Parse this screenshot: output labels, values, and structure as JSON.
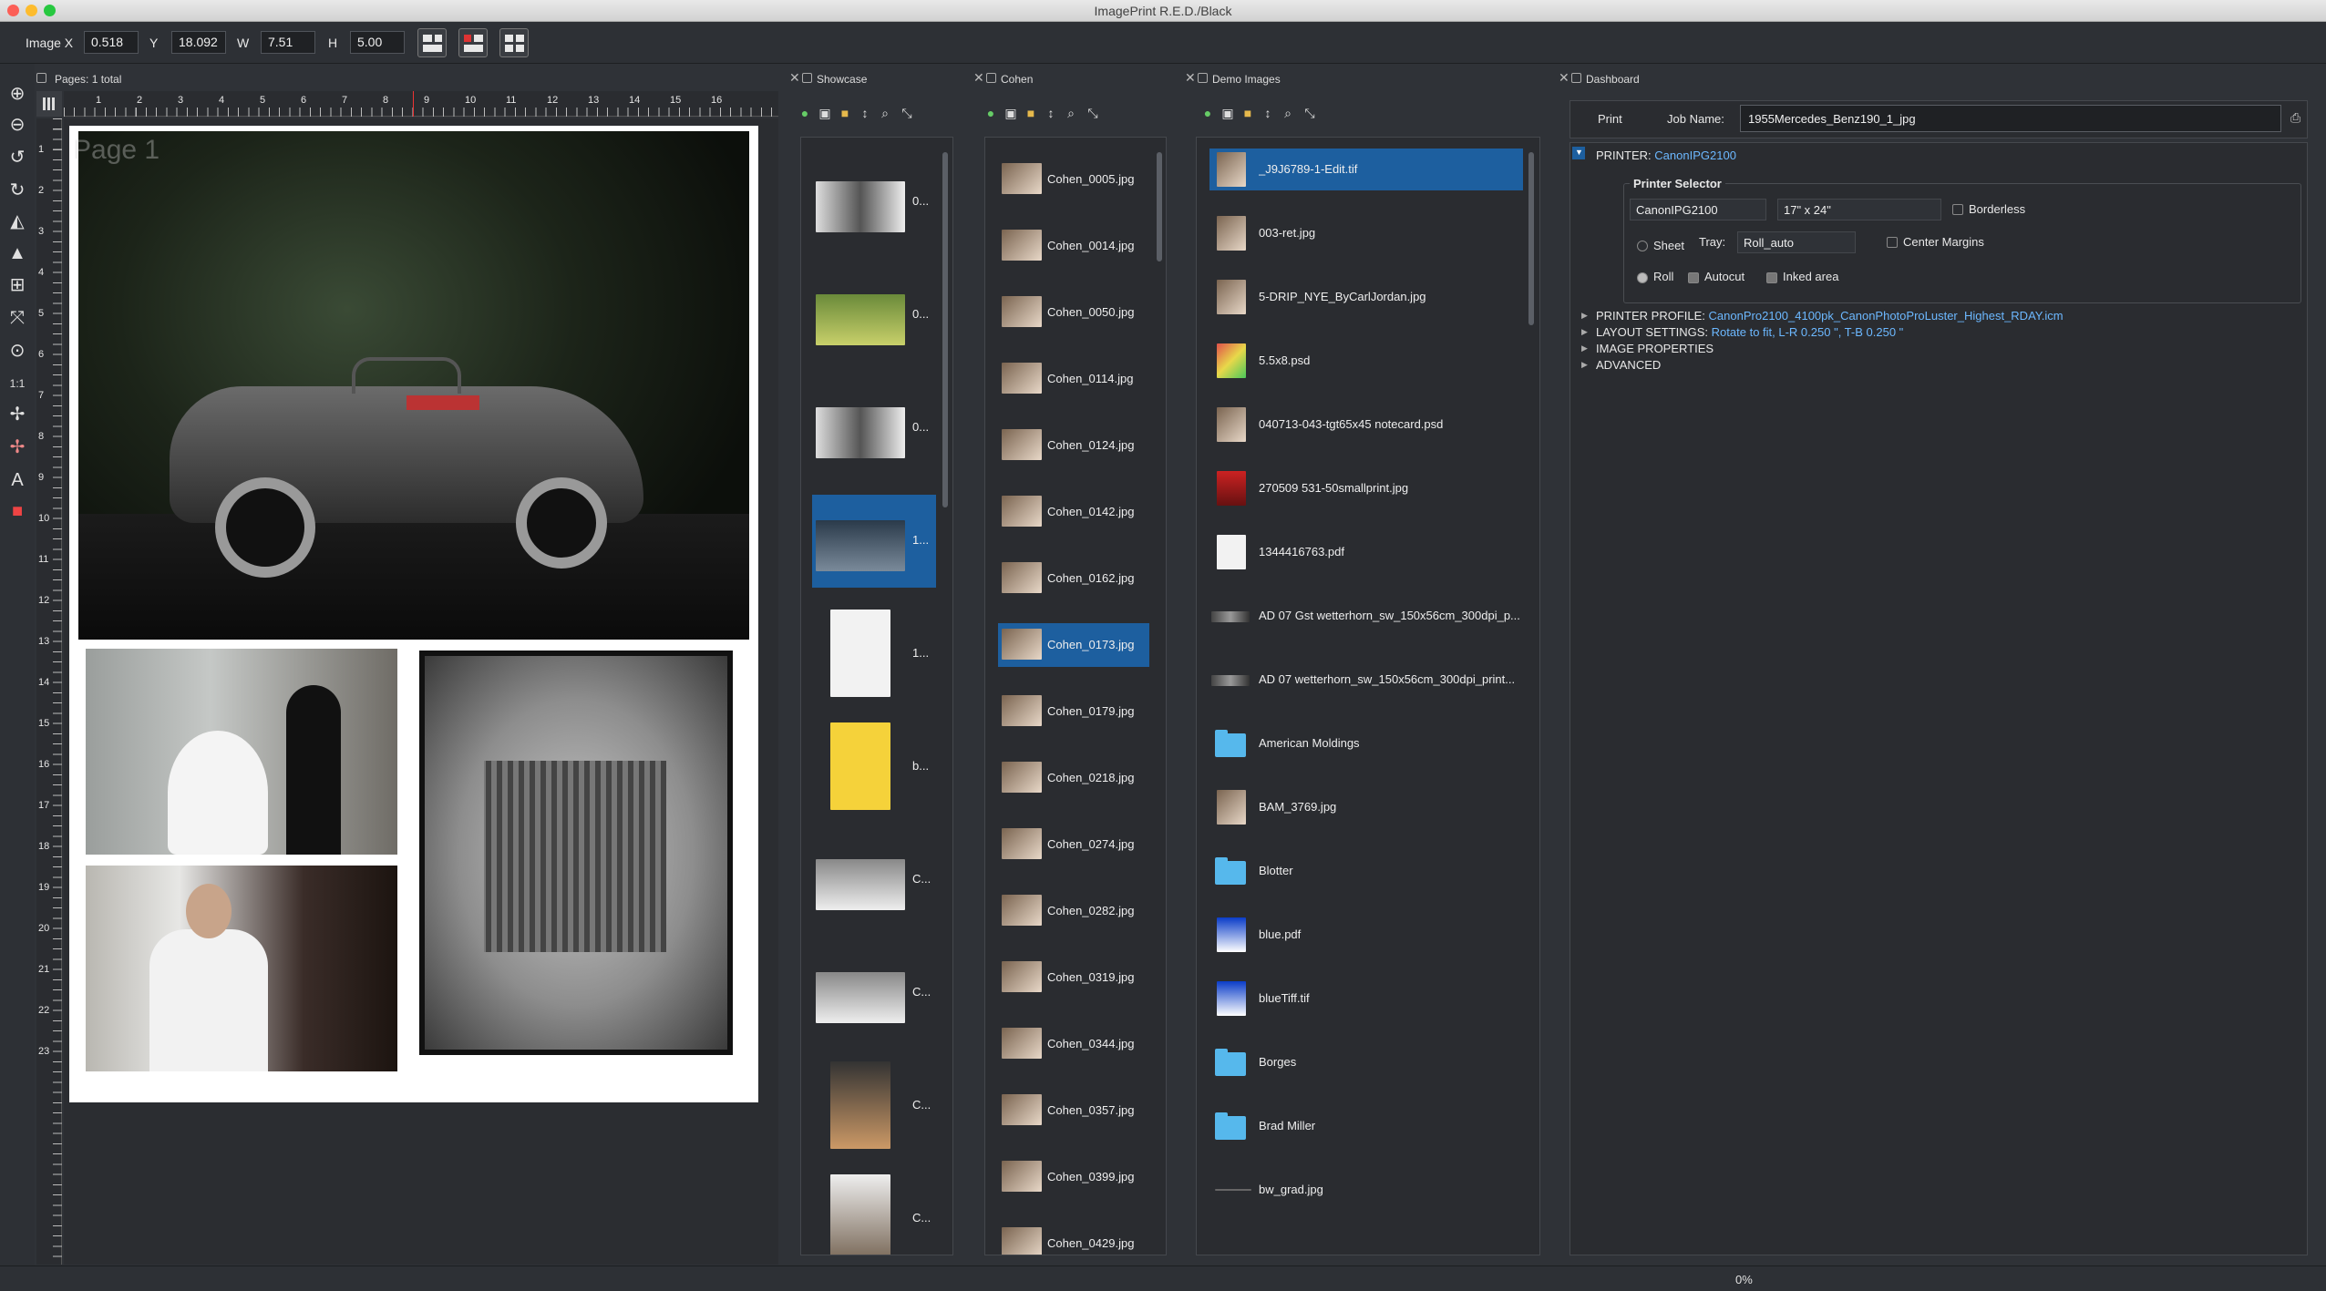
{
  "window": {
    "title": "ImagePrint R.E.D./Black"
  },
  "toolbar": {
    "image_x_label": "Image X",
    "image_x": "0.518",
    "y_label": "Y",
    "y": "18.092",
    "w_label": "W",
    "w": "7.51",
    "h_label": "H",
    "h": "5.00"
  },
  "canvas": {
    "pages_label": "Pages: 1 total",
    "page_watermark": "Page 1",
    "ruler_top": [
      "1",
      "2",
      "3",
      "4",
      "5",
      "6",
      "7",
      "8",
      "9",
      "10",
      "11",
      "12",
      "13",
      "14",
      "15",
      "16"
    ],
    "ruler_left": [
      "1",
      "2",
      "3",
      "4",
      "5",
      "6",
      "7",
      "8",
      "9",
      "10",
      "11",
      "12",
      "13",
      "14",
      "15",
      "16",
      "17",
      "18",
      "19",
      "20",
      "21",
      "22",
      "23"
    ]
  },
  "showcase": {
    "title": "Showcase",
    "items": [
      {
        "label": "0...",
        "kind": "bw"
      },
      {
        "label": "0...",
        "kind": "green"
      },
      {
        "label": "0...",
        "kind": "bw"
      },
      {
        "label": "1...",
        "kind": "car",
        "selected": true
      },
      {
        "label": "1...",
        "kind": "sketch"
      },
      {
        "label": "b...",
        "kind": "bart"
      },
      {
        "label": "C...",
        "kind": "street"
      },
      {
        "label": "C...",
        "kind": "street"
      },
      {
        "label": "C...",
        "kind": "dark"
      },
      {
        "label": "C...",
        "kind": "portrait"
      }
    ]
  },
  "cohen": {
    "title": "Cohen",
    "items": [
      {
        "label": "Cohen_0005.jpg"
      },
      {
        "label": "Cohen_0014.jpg"
      },
      {
        "label": "Cohen_0050.jpg"
      },
      {
        "label": "Cohen_0114.jpg"
      },
      {
        "label": "Cohen_0124.jpg"
      },
      {
        "label": "Cohen_0142.jpg"
      },
      {
        "label": "Cohen_0162.jpg"
      },
      {
        "label": "Cohen_0173.jpg",
        "selected": true
      },
      {
        "label": "Cohen_0179.jpg"
      },
      {
        "label": "Cohen_0218.jpg"
      },
      {
        "label": "Cohen_0274.jpg"
      },
      {
        "label": "Cohen_0282.jpg"
      },
      {
        "label": "Cohen_0319.jpg"
      },
      {
        "label": "Cohen_0344.jpg"
      },
      {
        "label": "Cohen_0357.jpg"
      },
      {
        "label": "Cohen_0399.jpg"
      },
      {
        "label": "Cohen_0429.jpg"
      }
    ]
  },
  "demo": {
    "title": "Demo Images",
    "items": [
      {
        "label": "_J9J6789-1-Edit.tif",
        "kind": "photo",
        "selected": true
      },
      {
        "label": "003-ret.jpg",
        "kind": "photo"
      },
      {
        "label": "5-DRIP_NYE_ByCarlJordan.jpg",
        "kind": "photo"
      },
      {
        "label": "5.5x8.psd",
        "kind": "gradient"
      },
      {
        "label": "040713-043-tgt65x45 notecard.psd",
        "kind": "photo"
      },
      {
        "label": "270509 531-50smallprint.jpg",
        "kind": "red"
      },
      {
        "label": "1344416763.pdf",
        "kind": "sketch"
      },
      {
        "label": "AD 07 Gst wetterhorn_sw_150x56cm_300dpi_p...",
        "kind": "pano"
      },
      {
        "label": "AD 07 wetterhorn_sw_150x56cm_300dpi_print...",
        "kind": "pano"
      },
      {
        "label": "American Moldings",
        "kind": "folder"
      },
      {
        "label": "BAM_3769.jpg",
        "kind": "photo"
      },
      {
        "label": "Blotter",
        "kind": "folder"
      },
      {
        "label": "blue.pdf",
        "kind": "blue"
      },
      {
        "label": "blueTiff.tif",
        "kind": "blue"
      },
      {
        "label": "Borges",
        "kind": "folder"
      },
      {
        "label": "Brad Miller",
        "kind": "folder"
      },
      {
        "label": "bw_grad.jpg",
        "kind": "line"
      }
    ]
  },
  "dashboard": {
    "title": "Dashboard",
    "print_label": "Print",
    "job_name_label": "Job Name:",
    "job_name": "1955Mercedes_Benz190_1_jpg",
    "printer_label": "PRINTER:",
    "printer_value": "CanonIPG2100",
    "printer_selector": "Printer Selector",
    "printer_select": "CanonIPG2100",
    "size_select": "17\" x 24\"",
    "borderless": "Borderless",
    "sheet": "Sheet",
    "tray_label": "Tray:",
    "tray_value": "Roll_auto",
    "center_margins": "Center Margins",
    "roll": "Roll",
    "autocut": "Autocut",
    "inked_area": "Inked area",
    "profile_label": "PRINTER PROFILE:",
    "profile_value": "CanonPro2100_4100pk_CanonPhotoProLuster_Highest_RDAY.icm",
    "layout_label": "LAYOUT SETTINGS:",
    "layout_value": "Rotate to fit, L-R 0.250 \", T-B 0.250 \"",
    "image_props": "IMAGE PROPERTIES",
    "advanced": "ADVANCED"
  },
  "status": {
    "progress": "0%"
  }
}
